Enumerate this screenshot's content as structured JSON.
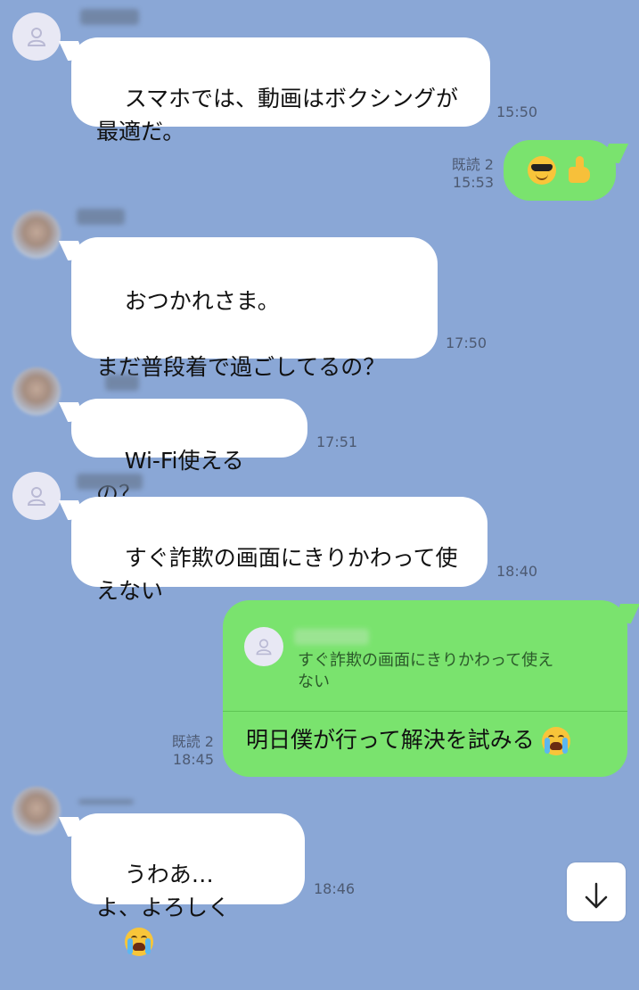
{
  "messages": [
    {
      "text": "スマホでは、動画はボクシングが\n最適だ。",
      "time": "15:50"
    },
    {
      "read": "既読 2",
      "time": "15:53",
      "emoji": [
        "smiling-face-with-sunglasses",
        "thumbs-up"
      ]
    },
    {
      "text": "おつかれさま。\n\nまだ普段着で過ごしてるの？",
      "time": "17:50"
    },
    {
      "text": "Wi-Fi使えるの？",
      "time": "17:51"
    },
    {
      "text": "すぐ詐欺の画面にきりかわって使\nえない",
      "time": "18:40"
    },
    {
      "quoted_text": "すぐ詐欺の画面にきりかわって使え\nない",
      "text": "明日僕が行って解決を試みる",
      "emoji": "loudly-crying-face",
      "read": "既読 2",
      "time": "18:45"
    },
    {
      "text": "うわあ…\nよ、よろしく",
      "emoji": "loudly-crying-face",
      "time": "18:46"
    }
  ],
  "scroll_button": {
    "icon": "arrow-down-icon"
  },
  "colors": {
    "background": "#8aa7d6",
    "incoming_bubble": "#ffffff",
    "outgoing_bubble": "#7ae36e",
    "meta_text": "#4d5a72"
  }
}
